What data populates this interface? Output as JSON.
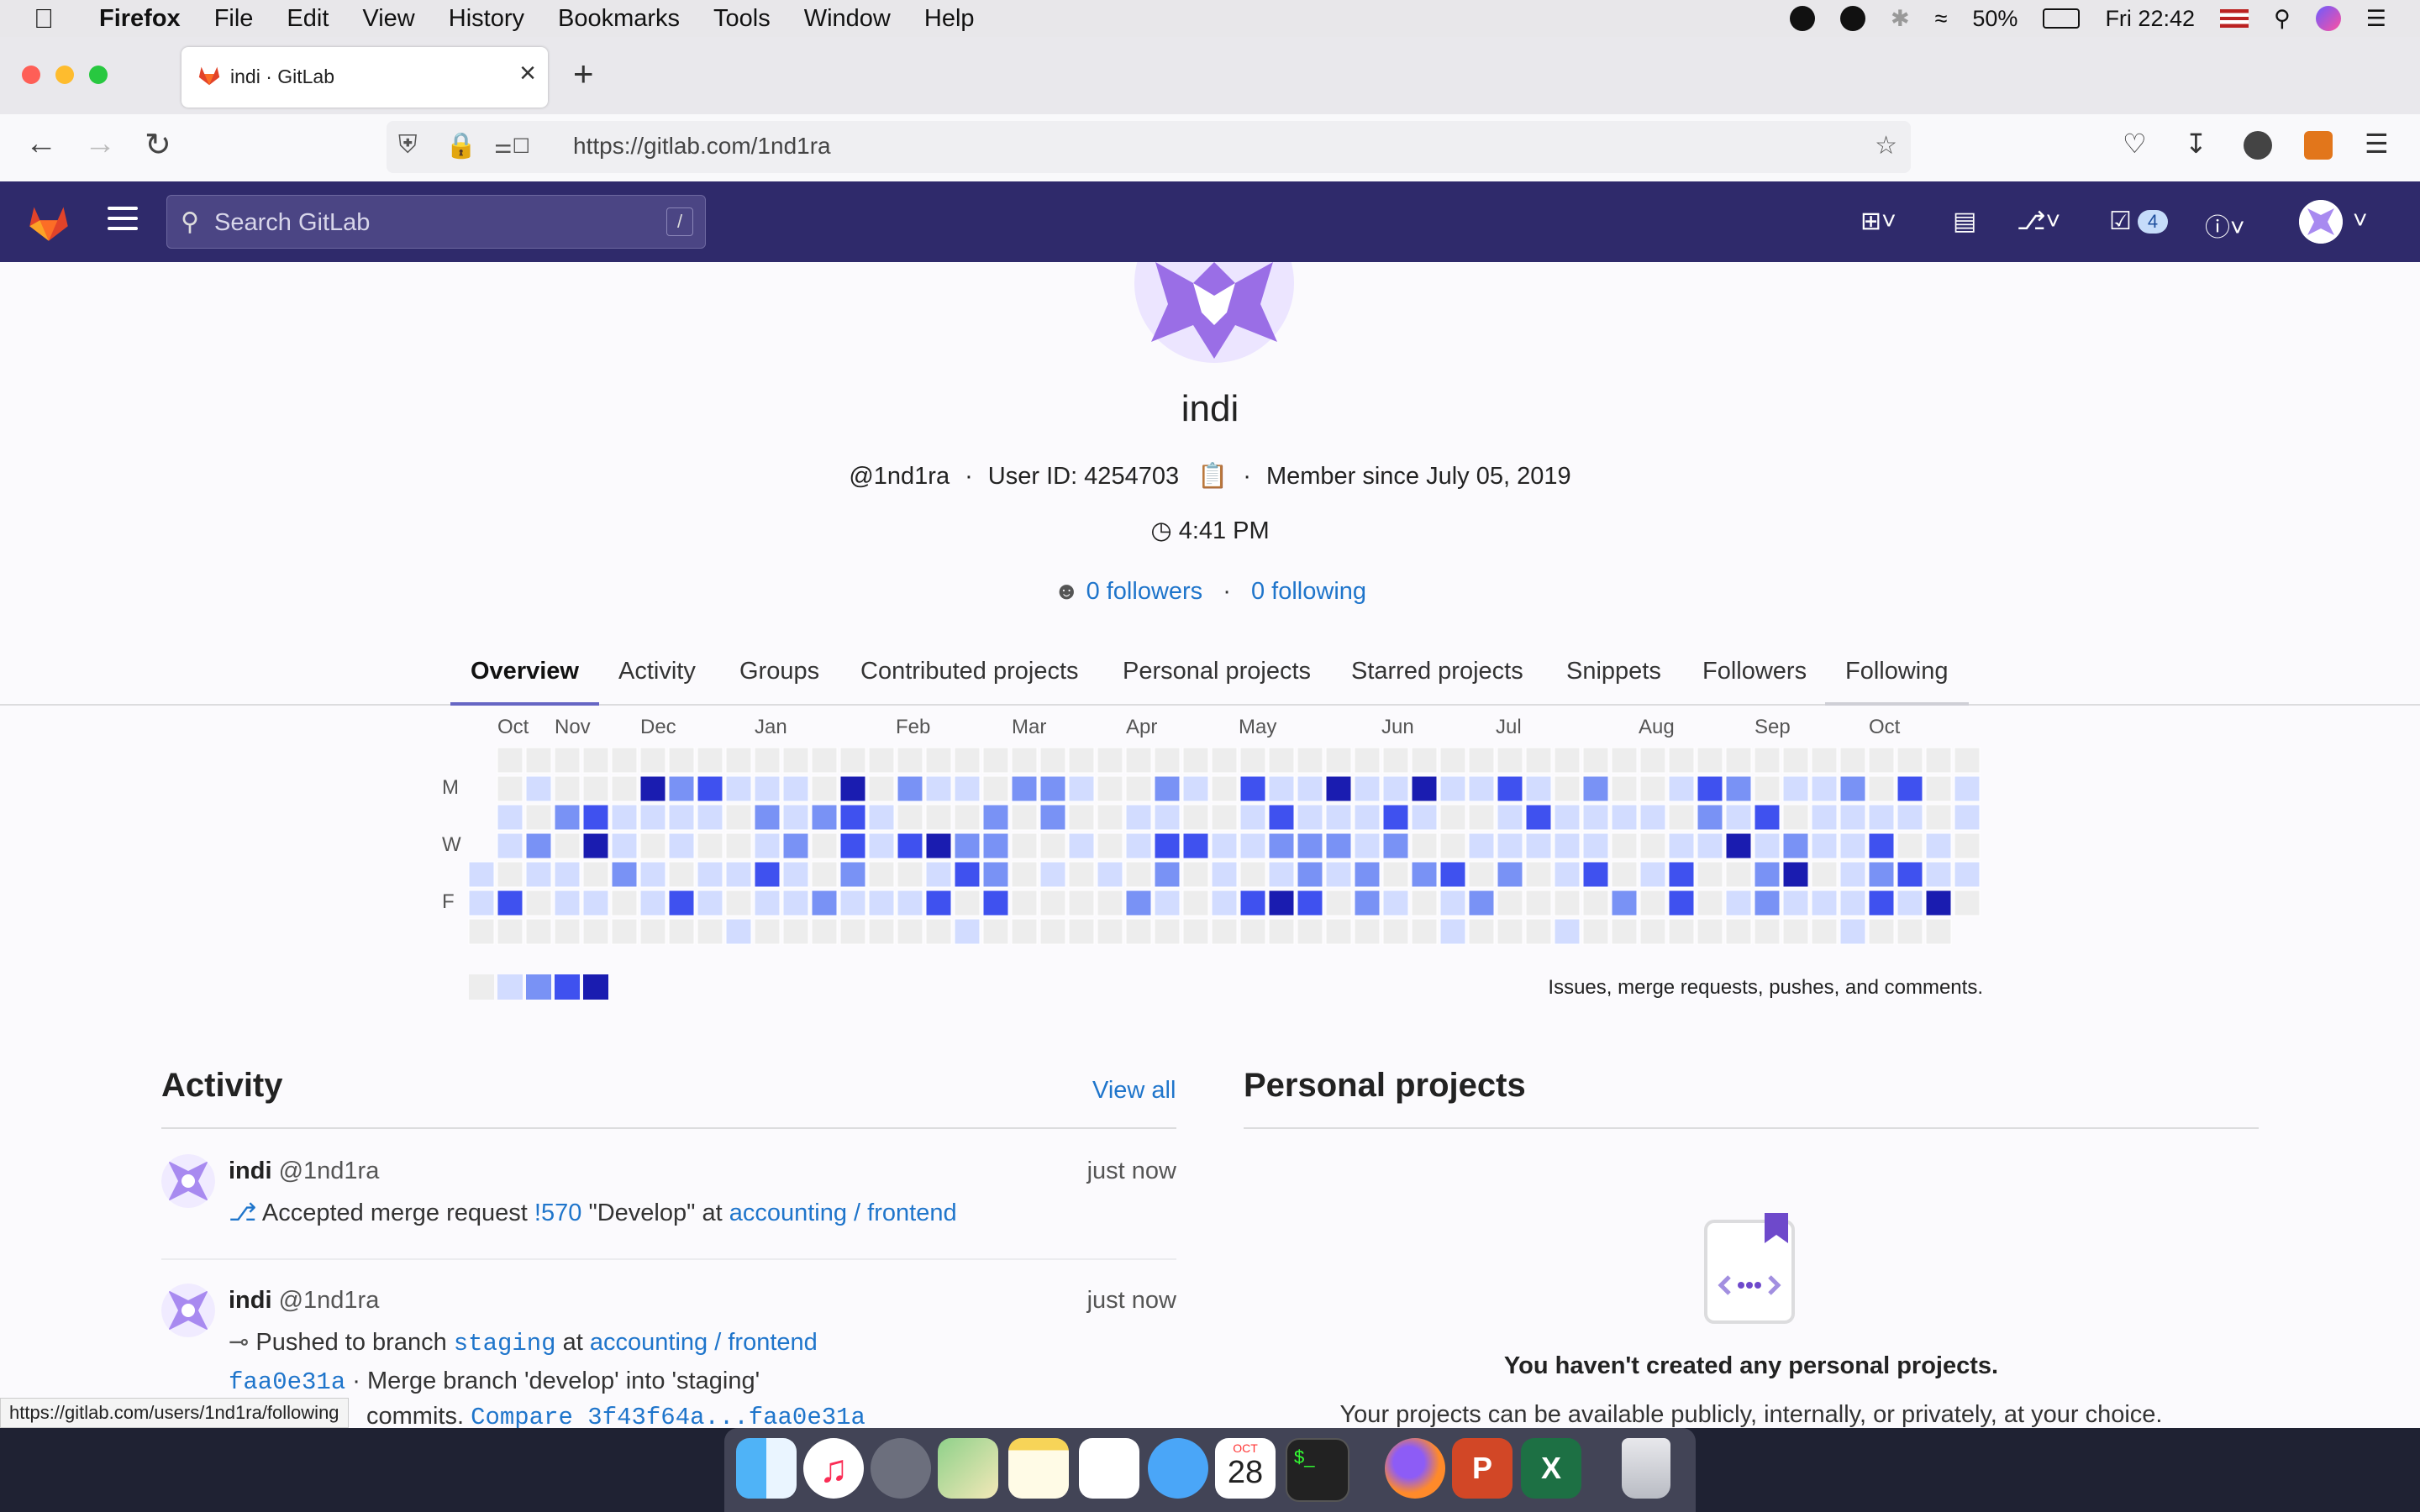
{
  "menubar": {
    "app": "Firefox",
    "items": [
      "File",
      "Edit",
      "View",
      "History",
      "Bookmarks",
      "Tools",
      "Window",
      "Help"
    ],
    "battery": "50%",
    "clock": "Fri 22:42"
  },
  "browser": {
    "tab_title": "indi · GitLab",
    "url": "https://gitlab.com/1nd1ra"
  },
  "gitlab": {
    "search_placeholder": "Search GitLab",
    "search_shortcut": "/",
    "todo_count": "4"
  },
  "profile": {
    "name": "indi",
    "handle": "@1nd1ra",
    "user_id": "User ID: 4254703",
    "member_since": "Member since July 05, 2019",
    "local_time": "4:41 PM",
    "followers": "0 followers",
    "following": "0 following"
  },
  "tabs": [
    "Overview",
    "Activity",
    "Groups",
    "Contributed projects",
    "Personal projects",
    "Starred projects",
    "Snippets",
    "Followers",
    "Following"
  ],
  "calendar": {
    "months": [
      "Oct",
      "Nov",
      "Dec",
      "Jan",
      "Feb",
      "Mar",
      "Apr",
      "May",
      "Jun",
      "Jul",
      "Aug",
      "Sep",
      "Oct"
    ],
    "day_labels": [
      "M",
      "W",
      "F"
    ],
    "note": "Issues, merge requests, pushes, and comments.",
    "colors": [
      "#ededed",
      "#d2dcff",
      "#7992f5",
      "#3f51ef",
      "#1a1cb0"
    ]
  },
  "activity": {
    "title": "Activity",
    "view_all": "View all",
    "events": [
      {
        "user": "indi",
        "handle": "@1nd1ra",
        "time": "just now",
        "action": "Accepted merge request",
        "ref": "!570",
        "quote": "\"Develop\" at",
        "project": "accounting / frontend"
      },
      {
        "user": "indi",
        "handle": "@1nd1ra",
        "time": "just now",
        "action": "Pushed to branch",
        "ref": "staging",
        "at": "at",
        "project": "accounting / frontend",
        "commit_sha": "faa0e31a",
        "commit_msg": "· Merge branch 'develop' into 'staging'",
        "more": "commits.",
        "compare": "Compare 3f43f64a...faa0e31a"
      }
    ]
  },
  "personal_projects": {
    "title": "Personal projects",
    "empty_title": "You haven't created any personal projects.",
    "empty_sub": "Your projects can be available publicly, internally, or privately, at your choice."
  },
  "status_url": "https://gitlab.com/users/1nd1ra/following",
  "dock": {
    "calendar_month": "OCT",
    "calendar_day": "28"
  }
}
